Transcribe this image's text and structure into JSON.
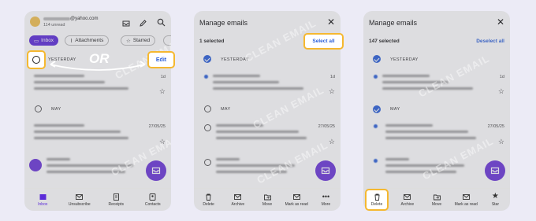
{
  "panel1": {
    "email": "@yahoo.com",
    "unread": "114 unread",
    "chips": [
      "Inbox",
      "Attachments",
      "Starred"
    ],
    "or_label": "OR",
    "edit_label": "Edit",
    "sections": [
      "YESTERDAY",
      "MAY"
    ],
    "dates": [
      "1d",
      "27/05/25"
    ],
    "nav": [
      "Inbox",
      "Unsubscribe",
      "Receipts",
      "Contacts"
    ]
  },
  "panel2": {
    "title": "Manage emails",
    "selected": "1 selected",
    "select_all": "Select all",
    "sections": [
      "YESTERDAY",
      "MAY"
    ],
    "dates": [
      "1d",
      "27/05/25"
    ],
    "actions": [
      "Delete",
      "Archive",
      "Move",
      "Mark as read",
      "More"
    ]
  },
  "panel3": {
    "title": "Manage emails",
    "selected": "147 selected",
    "deselect_all": "Deselect all",
    "sections": [
      "YESTERDAY",
      "MAY"
    ],
    "dates": [
      "1d",
      "27/05/25"
    ],
    "actions": [
      "Delete",
      "Archive",
      "Move",
      "Mark as read",
      "Star"
    ]
  },
  "watermark": "CLEAN EMAIL",
  "colors": {
    "accent": "#5b2bd8",
    "highlight": "#f5b830",
    "link": "#2a5fd9",
    "background": "#ecebf6"
  }
}
